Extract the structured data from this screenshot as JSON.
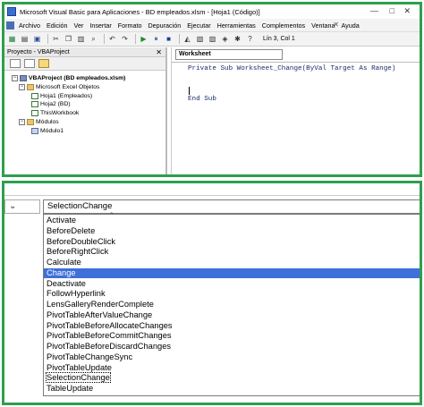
{
  "window": {
    "title": "Microsoft Visual Basic para Aplicaciones - BD empleados.xlsm - [Hoja1 (Código)]",
    "controls": [
      "—",
      "□",
      "✕"
    ]
  },
  "menubar": {
    "items": [
      "Archivo",
      "Edición",
      "Ver",
      "Insertar",
      "Formato",
      "Depuración",
      "Ejecutar",
      "Herramientas",
      "Complementos",
      "Ventana",
      "Ayuda"
    ],
    "close": "✕"
  },
  "toolbar": {
    "position": "Lín 3, Col 1",
    "buttons": [
      "excel-icon",
      "insert-icon",
      "save-icon",
      "cut-icon",
      "copy-icon",
      "paste-icon",
      "find-icon",
      "undo-icon",
      "redo-icon",
      "run-icon",
      "pause-icon",
      "stop-icon",
      "design-icon",
      "project-icon",
      "properties-icon",
      "object-browser-icon",
      "toolbox-icon",
      "help-icon"
    ]
  },
  "project": {
    "title": "Proyecto - VBAProject",
    "close": "✕",
    "tree": [
      {
        "label": "VBAProject (BD empleados.xlsm)",
        "bold": true,
        "icon": "project-icon",
        "expander": "−"
      },
      {
        "label": "Microsoft Excel Objetos",
        "icon": "folder-icon",
        "expander": "−"
      },
      {
        "label": "Hoja1 (Empleados)",
        "icon": "sheet-icon"
      },
      {
        "label": "Hoja2 (BD)",
        "icon": "sheet-icon"
      },
      {
        "label": "ThisWorkbook",
        "icon": "workbook-icon"
      },
      {
        "label": "Módulos",
        "icon": "folder-icon",
        "expander": "−"
      },
      {
        "label": "Módulo1",
        "icon": "module-icon"
      }
    ]
  },
  "code": {
    "object": "Worksheet",
    "lines": [
      "Private Sub Worksheet_Change(ByVal Target As Range)",
      "",
      "End Sub"
    ]
  },
  "procedure": {
    "selected": "SelectionChange",
    "highlighted": "Change",
    "items": [
      "Activate",
      "BeforeDelete",
      "BeforeDoubleClick",
      "BeforeRightClick",
      "Calculate",
      "Change",
      "Deactivate",
      "FollowHyperlink",
      "LensGalleryRenderComplete",
      "PivotTableAfterValueChange",
      "PivotTableBeforeAllocateChanges",
      "PivotTableBeforeCommitChanges",
      "PivotTableBeforeDiscardChanges",
      "PivotTableChangeSync",
      "PivotTableUpdate",
      "SelectionChange",
      "TableUpdate"
    ]
  },
  "colors": {
    "frame": "#2e9e4f",
    "selection": "#3f6fd8"
  }
}
